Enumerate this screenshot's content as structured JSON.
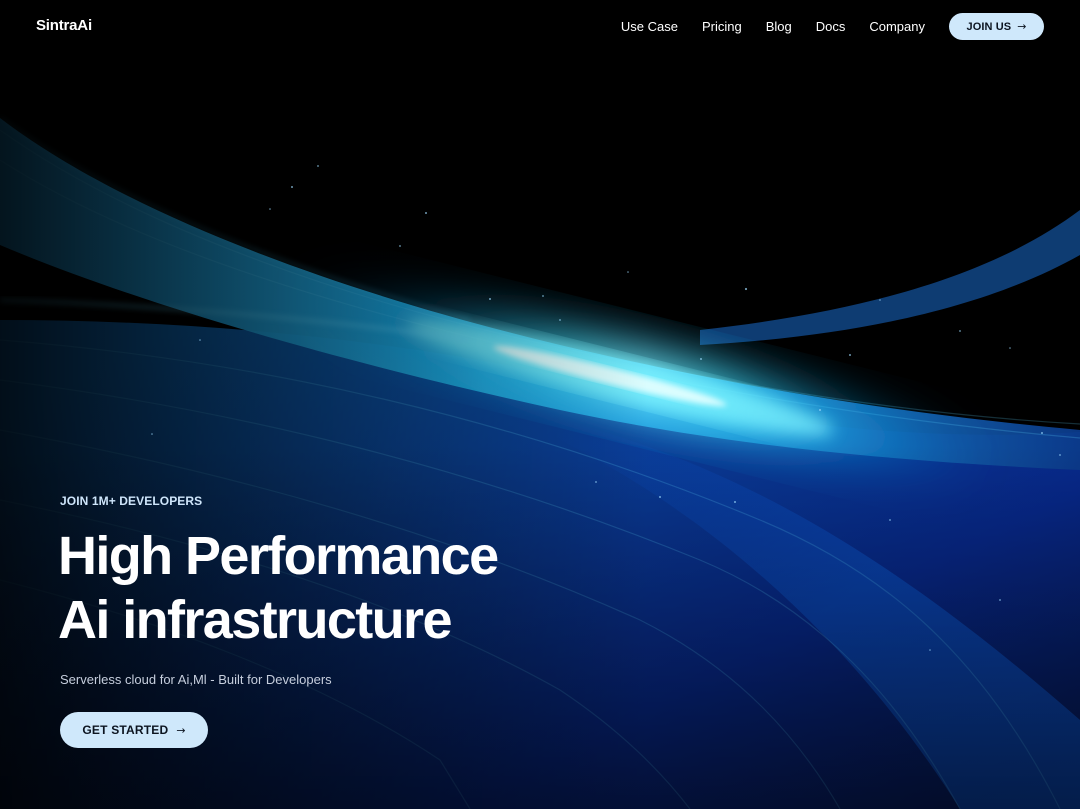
{
  "header": {
    "brand": "SintraAi",
    "nav": [
      {
        "label": "Use Case"
      },
      {
        "label": "Pricing"
      },
      {
        "label": "Blog"
      },
      {
        "label": "Docs"
      },
      {
        "label": "Company"
      }
    ],
    "join_button": {
      "label": "JOIN US",
      "icon": "arrow-right-icon"
    }
  },
  "hero": {
    "eyebrow": "JOIN 1M+ DEVELOPERS",
    "headline_line1": "High Performance",
    "headline_line2": "Ai infrastructure",
    "subtitle": "Serverless cloud for Ai,Ml - Built for Developers",
    "cta": {
      "label": "GET STARTED",
      "icon": "arrow-right-icon"
    }
  },
  "colors": {
    "background": "#000000",
    "button_fill": "#cfe8fb",
    "button_text": "#0c1420",
    "accent_cyan": "#3fe0ff",
    "accent_blue": "#0b3aa8"
  }
}
